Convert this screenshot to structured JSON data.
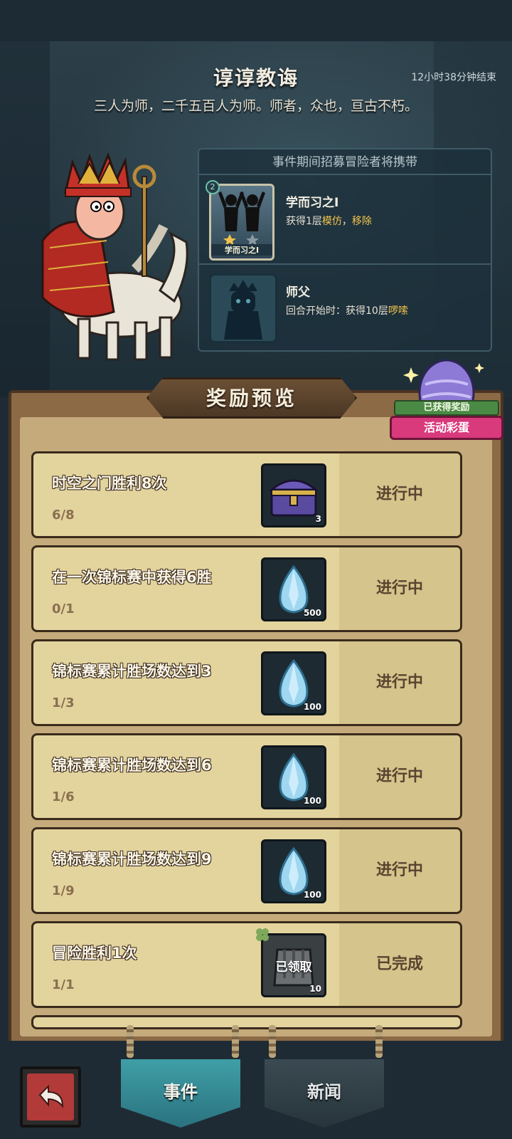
{
  "event": {
    "title": "谆谆教诲",
    "timer": "12小时38分钟结束",
    "quote": "三人为师，二千五百人为师。师者，众也，亘古不朽。"
  },
  "perk_panel": {
    "header": "事件期间招募冒险者将携带",
    "perks": [
      {
        "card_label": "学而习之I",
        "rank": "2",
        "name": "学而习之I",
        "desc_prefix": "获得1层",
        "kw1": "模仿",
        "sep": "，",
        "kw2": "移除"
      },
      {
        "name": "师父",
        "desc_prefix": "回合开始时：获得10层",
        "kw1": "啰嗦"
      }
    ]
  },
  "rewards": {
    "title": "奖励预览",
    "badge_top": "已获得奖励",
    "badge_bottom": "活动彩蛋",
    "tasks": [
      {
        "title": "时空之门胜利8次",
        "progress": "6/8",
        "reward_icon": "treasure-chest-icon",
        "count": "3",
        "status": "进行中"
      },
      {
        "title": "在一次锦标赛中获得6胜",
        "progress": "0/1",
        "reward_icon": "crystal-gem-icon",
        "count": "500",
        "status": "进行中"
      },
      {
        "title": "锦标赛累计胜场数达到3",
        "progress": "1/3",
        "reward_icon": "crystal-gem-icon",
        "count": "100",
        "status": "进行中"
      },
      {
        "title": "锦标赛累计胜场数达到6",
        "progress": "1/6",
        "reward_icon": "crystal-gem-icon",
        "count": "100",
        "status": "进行中"
      },
      {
        "title": "锦标赛累计胜场数达到9",
        "progress": "1/9",
        "reward_icon": "crystal-gem-icon",
        "count": "100",
        "status": "进行中"
      },
      {
        "title": "冒险胜利1次",
        "progress": "1/1",
        "reward_icon": "armor-pack-icon",
        "count": "10",
        "claimed": "已领取",
        "status": "已完成"
      }
    ]
  },
  "nav": {
    "tab_event": "事件",
    "tab_news": "新闻"
  },
  "colors": {
    "accent_keyword": "#f3c24a",
    "tab_active": "#3f9fa6",
    "badge_pink": "#d83a7c"
  }
}
